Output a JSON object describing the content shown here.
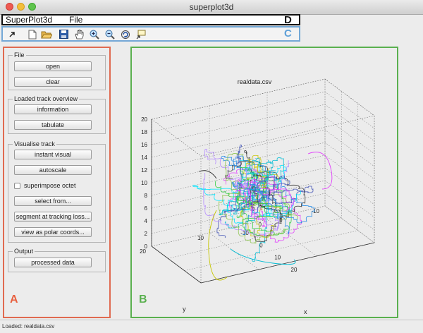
{
  "window": {
    "title": "superplot3d",
    "buttons": [
      {
        "name": "close",
        "color": "#ee5a52"
      },
      {
        "name": "minimize",
        "color": "#f3be3b"
      },
      {
        "name": "zoom",
        "color": "#5fc44d"
      }
    ]
  },
  "menubar": {
    "items": [
      "SuperPlot3d",
      "File"
    ],
    "label": "D"
  },
  "toolbar": {
    "label": "C",
    "icons": [
      "dock-arrow-icon",
      "new-file-icon",
      "open-folder-icon",
      "save-icon",
      "pan-hand-icon",
      "zoom-in-icon",
      "zoom-out-icon",
      "rotate-3d-icon",
      "data-cursor-icon"
    ]
  },
  "panel_a": {
    "label": "A",
    "file": {
      "title": "File",
      "open": "open",
      "clear": "clear"
    },
    "overview": {
      "title": "Loaded track overview",
      "information": "information",
      "tabulate": "tabulate"
    },
    "visualise": {
      "title": "Visualise track",
      "instant_visual": "instant visual",
      "autoscale": "autoscale",
      "superimpose_octet": "superimpose octet",
      "superimpose_checked": false,
      "select_from": "select from...",
      "segment": "segment at tracking loss...",
      "polar": "view as polar coords..."
    },
    "output": {
      "title": "Output",
      "processed": "processed data"
    }
  },
  "panel_b": {
    "label": "B"
  },
  "status": {
    "text": "Loaded: realdata.csv"
  },
  "colors": {
    "panel_a_border": "#e06a50",
    "panel_b_border": "#5ab04f",
    "toolbar_border": "#74a8d6",
    "menubar_border": "#111111"
  },
  "chart_data": {
    "type": "line",
    "title": "realdata.csv",
    "xlabel": "x",
    "ylabel": "y",
    "zlabel": "",
    "x_ticks": [
      -10,
      0,
      10,
      20
    ],
    "y_ticks": [
      -10,
      0,
      10,
      20
    ],
    "z_ticks": [
      0,
      2,
      4,
      6,
      8,
      10,
      12,
      14,
      16,
      18,
      20
    ],
    "xlim": [
      -10,
      20
    ],
    "ylim": [
      -10,
      20
    ],
    "zlim": [
      0,
      20
    ],
    "grid": true,
    "series_colors": [
      "#2ecc40",
      "#00bcd4",
      "#3f51b5",
      "#e040fb",
      "#c6c600",
      "#333333",
      "#00e5ff",
      "#8bc34a",
      "#1e88e5",
      "#b388ff"
    ]
  }
}
